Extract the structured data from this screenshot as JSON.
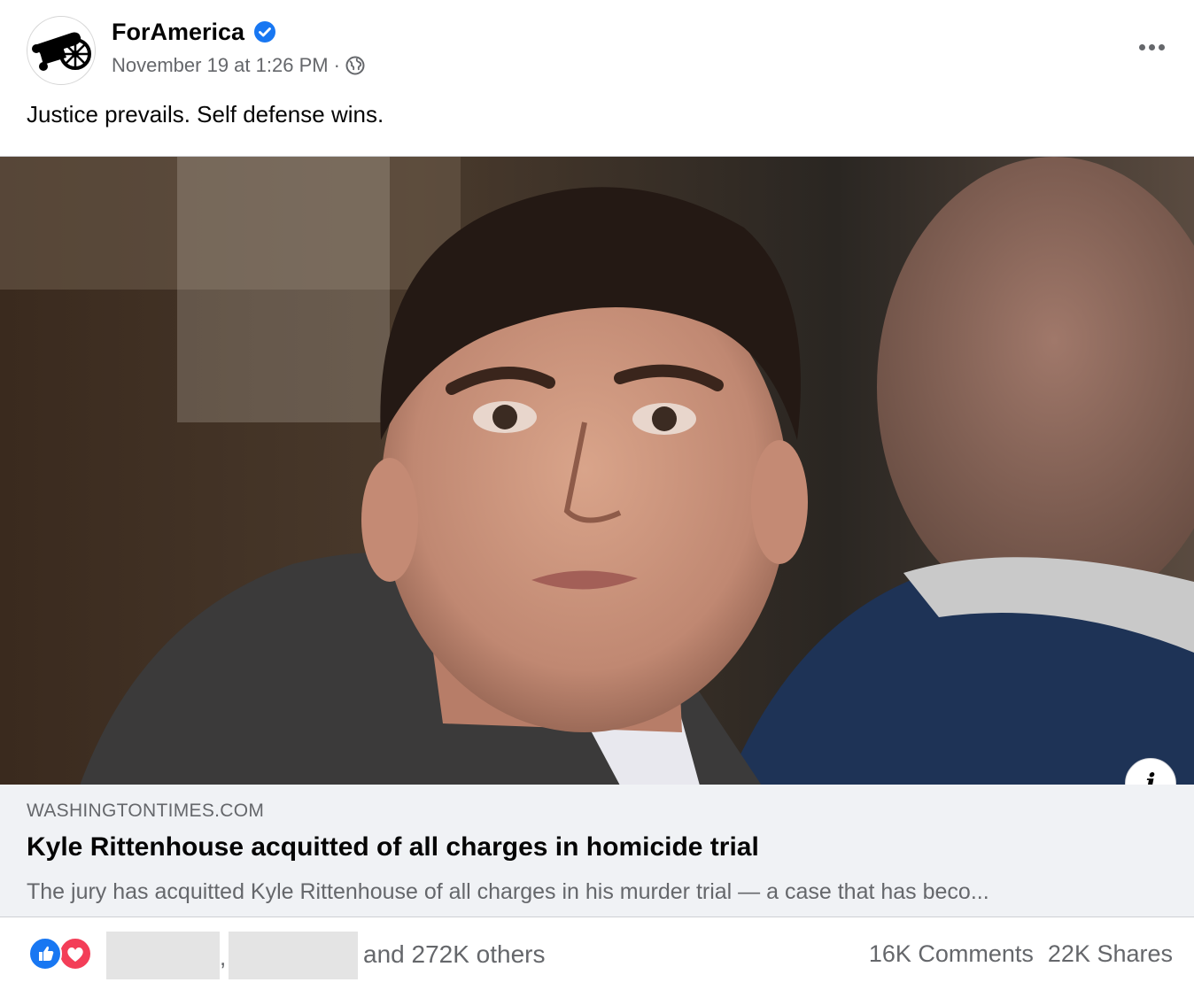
{
  "post": {
    "page_name": "ForAmerica",
    "verified": true,
    "timestamp": "November 19 at 1:26 PM",
    "separator": "·",
    "audience_icon": "globe-icon",
    "more_icon": "more-options-icon",
    "text": "Justice prevails. Self defense wins."
  },
  "link_preview": {
    "domain": "WASHINGTONTIMES.COM",
    "title": "Kyle Rittenhouse acquitted of all charges in homicide trial",
    "description": "The jury has acquitted Kyle Rittenhouse of all charges in his murder trial — a case that has beco...",
    "info_label": "i"
  },
  "engagement": {
    "reactions": [
      "like",
      "love"
    ],
    "comma": ",",
    "reactions_text": "and 272K others",
    "comments": "16K Comments",
    "shares": "22K Shares"
  },
  "colors": {
    "brand_blue": "#1877f2",
    "love_red": "#f33e58",
    "secondary_text": "#65676b",
    "link_card_bg": "#f0f2f5"
  }
}
